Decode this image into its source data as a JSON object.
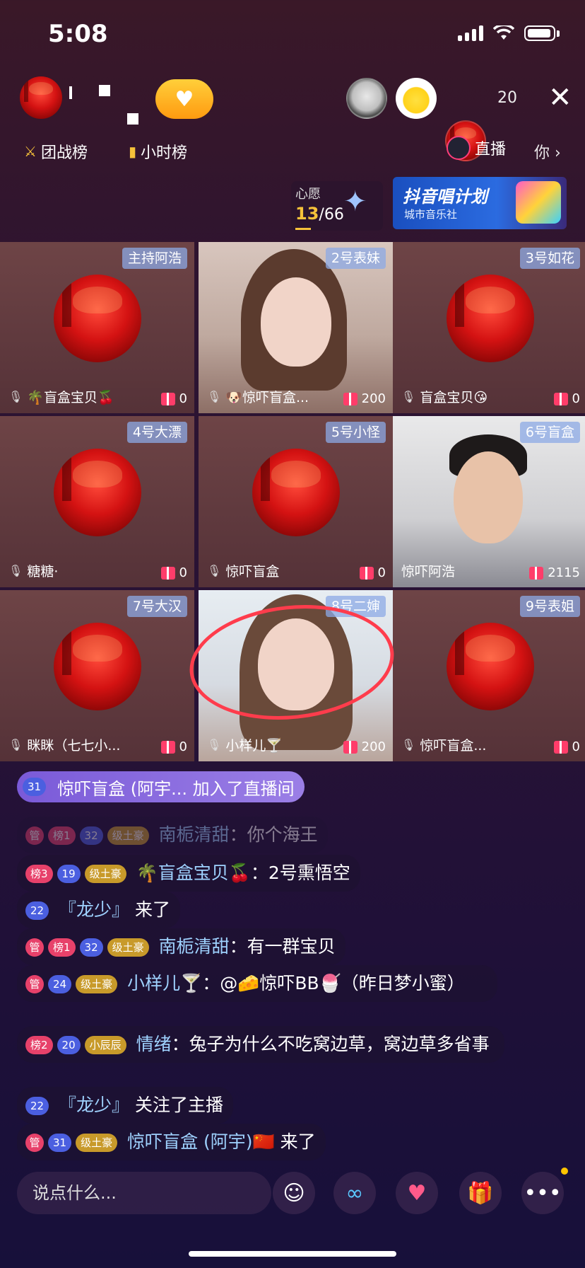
{
  "status_bar": {
    "time": "5:08"
  },
  "header": {
    "host_name": "",
    "follow_icon": "plus-heart-icon",
    "viewer_count": "20",
    "close_icon": "close-icon"
  },
  "rank_bar": {
    "team_battle": "团战榜",
    "hourly": "小时榜",
    "live_label": "直播",
    "more": "你",
    "more_arrow": "›"
  },
  "wish": {
    "title": "心愿",
    "current": "13",
    "total": "/66"
  },
  "promo": {
    "title": "抖音唱计划",
    "subtitle": "城市音乐社"
  },
  "seats": [
    {
      "label": "主持阿浩",
      "name": "🌴盲盒宝贝🍒",
      "gifts": "0"
    },
    {
      "label": "2号表妹",
      "name": "🐶惊吓盲盒...",
      "gifts": "200"
    },
    {
      "label": "3号如花",
      "name": "盲盒宝贝😘",
      "gifts": "0"
    },
    {
      "label": "4号大漂",
      "name": "糖糖·",
      "gifts": "0"
    },
    {
      "label": "5号小怪",
      "name": "惊吓盲盒",
      "gifts": "0"
    },
    {
      "label": "6号盲盒",
      "name": "惊吓阿浩",
      "gifts": "2115"
    },
    {
      "label": "7号大汉",
      "name": "眯眯（七七小...",
      "gifts": "0"
    },
    {
      "label": "8号二婶",
      "name": "小样儿🍸",
      "gifts": "200"
    },
    {
      "label": "9号表姐",
      "name": "惊吓盲盒...",
      "gifts": "0"
    }
  ],
  "join_notice": {
    "level": "31",
    "text": "惊吓盲盒 (阿宇... 加入了直播间"
  },
  "chat": [
    {
      "badges": [
        "管",
        "榜1",
        "32",
        "级土豪"
      ],
      "user": "南栀清甜",
      "text": "你个海王"
    },
    {
      "badges": [
        "榜3",
        "19",
        "级土豪"
      ],
      "user": "🌴盲盒宝贝🍒",
      "text": "2号熏悟空"
    },
    {
      "badges": [
        "22"
      ],
      "user": "『龙少』",
      "text": "来了"
    },
    {
      "badges": [
        "管",
        "榜1",
        "32",
        "级土豪"
      ],
      "user": "南栀清甜",
      "text": "有一群宝贝"
    },
    {
      "badges": [
        "管",
        "24",
        "级土豪"
      ],
      "user": "小样儿🍸",
      "text": "@🧀惊吓BB🍧（昨日梦小蜜）"
    },
    {
      "badges": [
        "榜2",
        "20",
        "小辰辰"
      ],
      "user": "情绪",
      "text": "兔子为什么不吃窝边草，窝边草多省事"
    },
    {
      "badges": [
        "22"
      ],
      "user": "『龙少』",
      "text": "关注了主播"
    },
    {
      "badges": [
        "管",
        "31",
        "级土豪"
      ],
      "user": "惊吓盲盒 (阿宇)🇨🇳",
      "text": "来了"
    }
  ],
  "bottom": {
    "input_placeholder": "说点什么..."
  },
  "colors": {
    "accent_gold": "#f6c23a",
    "badge_red": "#e7416a",
    "badge_blue": "#4b5fe0",
    "username_blue": "#9fd2ff"
  }
}
